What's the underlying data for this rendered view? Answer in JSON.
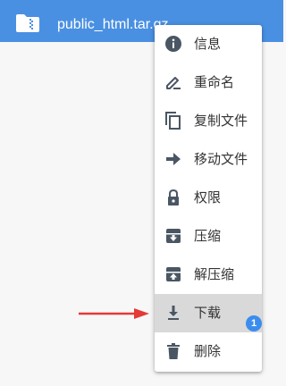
{
  "file": {
    "name": "public_html.tar.gz",
    "icon": "zip-folder-icon"
  },
  "menu": {
    "items": [
      {
        "label": "信息",
        "icon": "info-icon"
      },
      {
        "label": "重命名",
        "icon": "pencil-icon"
      },
      {
        "label": "复制文件",
        "icon": "copy-icon"
      },
      {
        "label": "移动文件",
        "icon": "arrow-right-icon"
      },
      {
        "label": "权限",
        "icon": "lock-icon"
      },
      {
        "label": "压缩",
        "icon": "archive-icon"
      },
      {
        "label": "解压缩",
        "icon": "unarchive-icon"
      },
      {
        "label": "下载",
        "icon": "download-icon",
        "highlighted": true
      },
      {
        "label": "删除",
        "icon": "trash-icon"
      }
    ]
  },
  "annotation": {
    "badge": "1"
  },
  "colors": {
    "accent": "#4a90e2",
    "icon": "#4a5663",
    "highlight": "#d9d9d9",
    "arrow": "#e53935",
    "badge": "#3b8ded"
  }
}
